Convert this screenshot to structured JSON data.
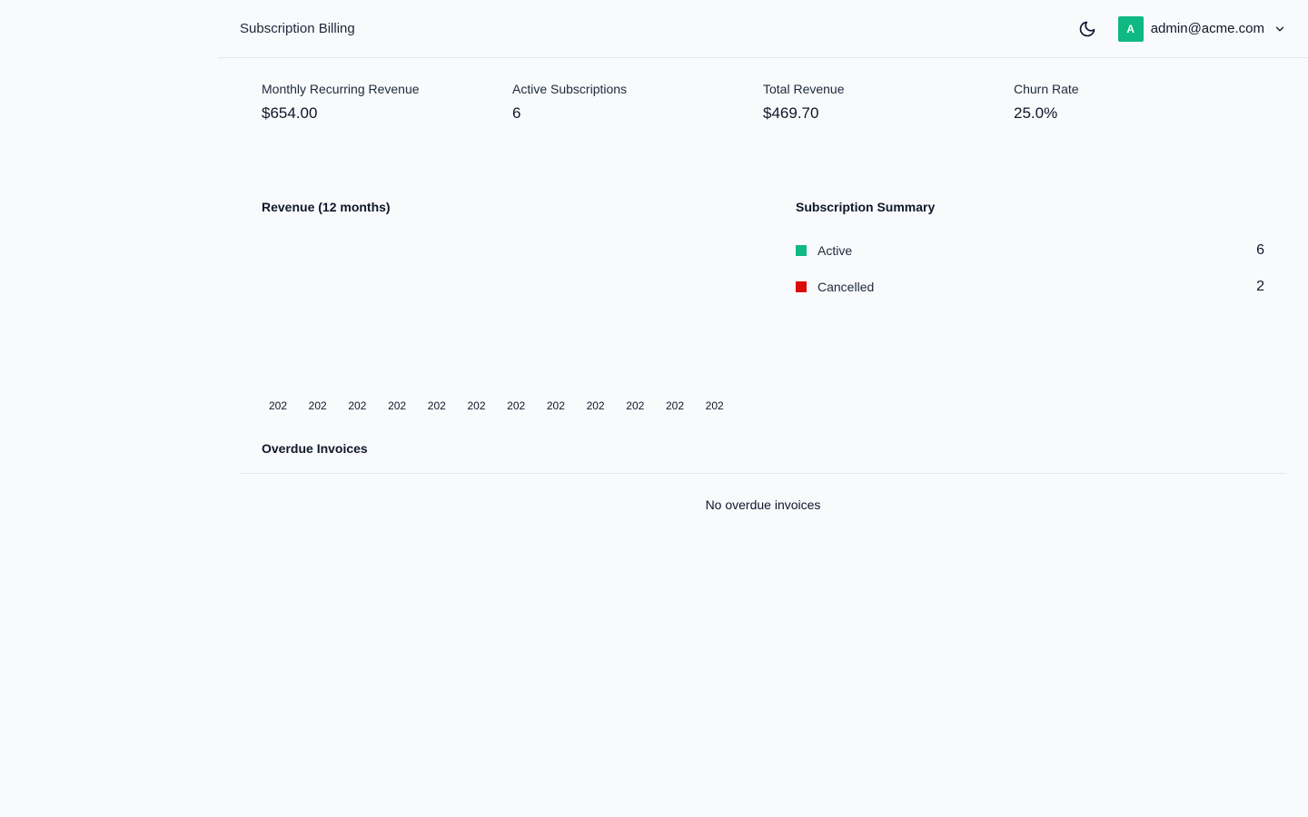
{
  "header": {
    "title": "Subscription Billing",
    "user_initial": "A",
    "user_email": "admin@acme.com"
  },
  "icons": {
    "theme": "moon-icon",
    "menu": "chevron-down-icon"
  },
  "colors": {
    "accent": "#10b981",
    "active": "#10b981",
    "cancelled": "#dc0a0a"
  },
  "stats": [
    {
      "label": "Monthly Recurring Revenue",
      "value": "$654.00"
    },
    {
      "label": "Active Subscriptions",
      "value": "6"
    },
    {
      "label": "Total Revenue",
      "value": "$469.70"
    },
    {
      "label": "Churn Rate",
      "value": "25.0%"
    }
  ],
  "revenue": {
    "title": "Revenue (12 months)"
  },
  "chart_data": {
    "type": "bar",
    "title": "Revenue (12 months)",
    "categories": [
      "202",
      "202",
      "202",
      "202",
      "202",
      "202",
      "202",
      "202",
      "202",
      "202",
      "202",
      "202"
    ],
    "values": [
      0,
      0,
      0,
      0,
      0,
      0,
      0,
      0,
      0,
      0,
      0,
      0
    ],
    "xlabel": "",
    "ylabel": "",
    "grid": false
  },
  "summary": {
    "title": "Subscription Summary",
    "items": [
      {
        "label": "Active",
        "count": "6"
      },
      {
        "label": "Cancelled",
        "count": "2"
      }
    ]
  },
  "overdue": {
    "title": "Overdue Invoices",
    "empty_text": "No overdue invoices"
  }
}
